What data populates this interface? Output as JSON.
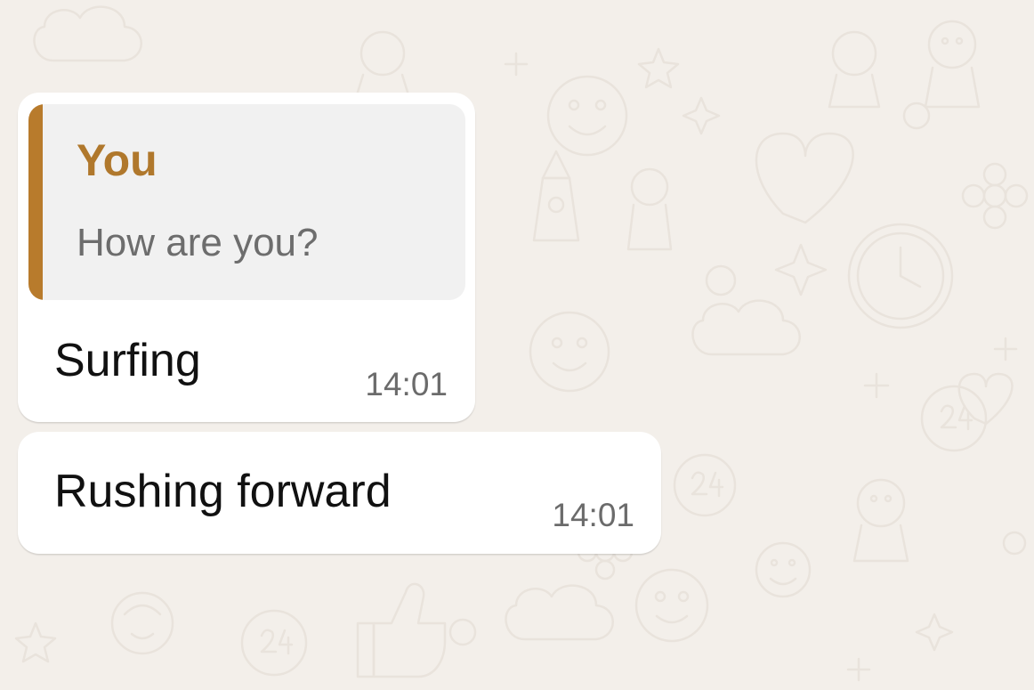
{
  "colors": {
    "wallpaper": "#f3efea",
    "doodle": "#e9e3dc",
    "bubble": "#ffffff",
    "quote_background": "#f1f1f1",
    "quote_accent": "#b87b2c",
    "quote_author": "#b0782c",
    "quote_text": "#6d6d6d",
    "message_text": "#111111",
    "timestamp": "#6b6b6b"
  },
  "messages": [
    {
      "quoted": {
        "author": "You",
        "text": "How are you?"
      },
      "text": "Surfing",
      "time": "14:01"
    },
    {
      "text": "Rushing forward",
      "time": "14:01"
    }
  ]
}
